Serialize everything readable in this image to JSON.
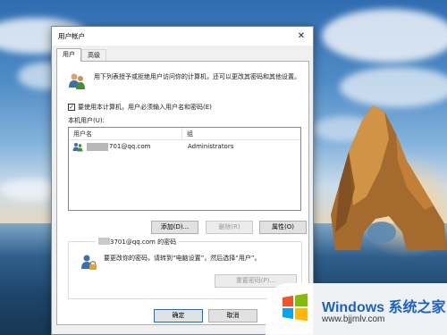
{
  "window": {
    "title": "用户帐户",
    "close_glyph": "✕"
  },
  "tabs": [
    {
      "label": "用户",
      "active": true
    },
    {
      "label": "高级",
      "active": false
    }
  ],
  "intro": {
    "text": "用下列表授予或拒绝用户访问你的计算机，还可以更改其密码和其他设置。"
  },
  "require_login": {
    "checked": true,
    "label": "要使用本计算机，用户必须输入用户名和密码(E)"
  },
  "users": {
    "label": "本机用户(U):",
    "columns": [
      "用户名",
      "组"
    ],
    "rows": [
      {
        "name_suffix": "701@qq.com",
        "group": "Administrators"
      }
    ]
  },
  "actions": {
    "add": "添加(D)...",
    "remove": "删除(R)",
    "properties": "属性(O)"
  },
  "password": {
    "legend_suffix": "3701@qq.com 的密码",
    "text": "要更改你的密码，请转到“电脑设置”，然后选择“用户”。",
    "reset_button": "重置密码(P)..."
  },
  "footer": {
    "ok": "确定",
    "cancel": "取消"
  },
  "watermark": {
    "title": "Windows 系统之家",
    "url": "www.bjjmlv.com"
  },
  "colors": {
    "accent": "#1a63c2",
    "window_bg": "#f0f0f0",
    "button_bg": "#e1e1e1"
  }
}
